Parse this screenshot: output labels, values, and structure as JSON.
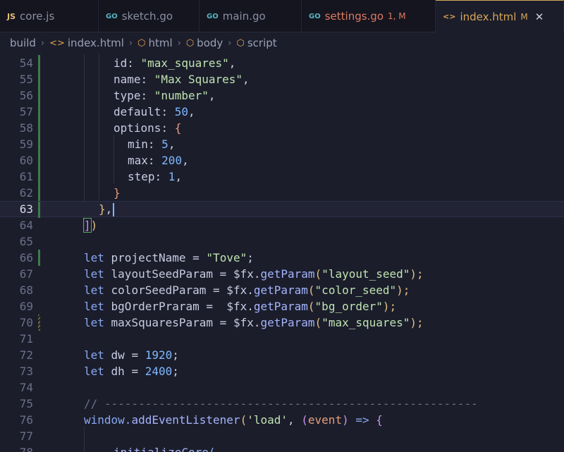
{
  "tabs": [
    {
      "icon": "JS",
      "label": "core.js",
      "type": "js"
    },
    {
      "icon": "GO",
      "label": "sketch.go",
      "type": "go"
    },
    {
      "icon": "GO",
      "label": "main.go",
      "type": "go"
    },
    {
      "icon": "GO",
      "label": "settings.go",
      "badge": "1, M",
      "type": "go"
    },
    {
      "icon": "<>",
      "label": "index.html",
      "badge": "M",
      "type": "html",
      "active": true
    }
  ],
  "breadcrumb": [
    "build",
    "index.html",
    "html",
    "body",
    "script"
  ],
  "line_numbers": [
    "54",
    "55",
    "56",
    "57",
    "58",
    "59",
    "60",
    "61",
    "62",
    "63",
    "64",
    "65",
    "66",
    "67",
    "68",
    "69",
    "70",
    "71",
    "72",
    "73",
    "74",
    "75",
    "76",
    "77",
    "78"
  ],
  "code": {
    "l54": [
      "id",
      ": ",
      "\"max_squares\"",
      ","
    ],
    "l55": [
      "name",
      ": ",
      "\"Max Squares\"",
      ","
    ],
    "l56": [
      "type",
      ": ",
      "\"number\"",
      ","
    ],
    "l57": [
      "default",
      ": ",
      "50",
      ","
    ],
    "l58": [
      "options",
      ": ",
      "{"
    ],
    "l59": [
      "min",
      ": ",
      "5",
      ","
    ],
    "l60": [
      "max",
      ": ",
      "200",
      ","
    ],
    "l61": [
      "step",
      ": ",
      "1",
      ","
    ],
    "l62": [
      "}"
    ],
    "l63": [
      "}",
      ","
    ],
    "l64": [
      "]",
      ")"
    ],
    "l66": [
      "let",
      " projectName ",
      "=",
      " ",
      "\"Tove\"",
      ";"
    ],
    "l67": [
      "let",
      " layoutSeedParam ",
      "=",
      " $fx.",
      "getParam",
      "(",
      "\"layout_seed\"",
      ");"
    ],
    "l68": [
      "let",
      " colorSeedParam ",
      "=",
      " $fx.",
      "getParam",
      "(",
      "\"color_seed\"",
      ");"
    ],
    "l69": [
      "let",
      " bgOrderPraram ",
      "=",
      "  $fx.",
      "getParam",
      "(",
      "\"bg_order\"",
      ");"
    ],
    "l70": [
      "let",
      " maxSquaresParam ",
      "=",
      " $fx.",
      "getParam",
      "(",
      "\"max_squares\"",
      ");"
    ],
    "l72": [
      "let",
      " dw ",
      "=",
      " ",
      "1920",
      ";"
    ],
    "l73": [
      "let",
      " dh ",
      "=",
      " ",
      "2400",
      ";"
    ],
    "l75": [
      "// -------------------------------------------------------"
    ],
    "l76": [
      "window.",
      "addEventListener",
      "(",
      "'load'",
      ", ",
      "(",
      "event",
      ")",
      " => ",
      "{"
    ],
    "l78": [
      "initializeCore",
      "("
    ]
  },
  "colors": {
    "accent": "#d8a657",
    "background": "#1b1d2b",
    "tabbar": "#14151f"
  }
}
